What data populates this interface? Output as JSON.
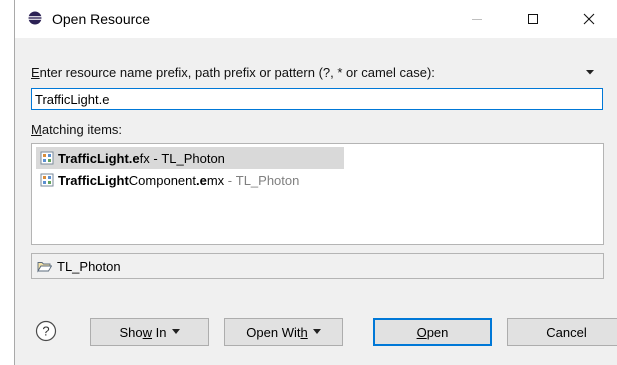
{
  "window": {
    "title": "Open Resource",
    "controls": {
      "minimize": "minimize-icon",
      "maximize": "maximize-icon",
      "close": "close-icon"
    }
  },
  "prompt": {
    "label_first": "E",
    "label_rest": "nter resource name prefix, path prefix or pattern (?, * or camel case):"
  },
  "search": {
    "value": "TrafficLight.e",
    "focus_color": "#0078d7"
  },
  "matching": {
    "label_first": "M",
    "label_rest": "atching items:"
  },
  "results": [
    {
      "name_bold": "TrafficLight.e",
      "name_rest": "fx",
      "separator": " - ",
      "project": "TL_Photon",
      "selected": true
    },
    {
      "name_bold1": "TrafficLight",
      "name_mid": "Component",
      "name_bold2": ".e",
      "name_rest": "mx",
      "separator": " - ",
      "project": "TL_Photon",
      "selected": false
    }
  ],
  "folder": {
    "icon": "folder-open-icon",
    "label": "TL_Photon"
  },
  "buttons": {
    "show_in_pre": "Sho",
    "show_in_u": "w",
    "show_in_post": " In",
    "open_with_pre": "Open Wit",
    "open_with_u": "h",
    "open_u": "O",
    "open_post": "pen",
    "cancel": "Cancel"
  },
  "colors": {
    "accent": "#0078d7",
    "selection": "#d9d9d9",
    "dialog_bg": "#f0f0f0"
  }
}
